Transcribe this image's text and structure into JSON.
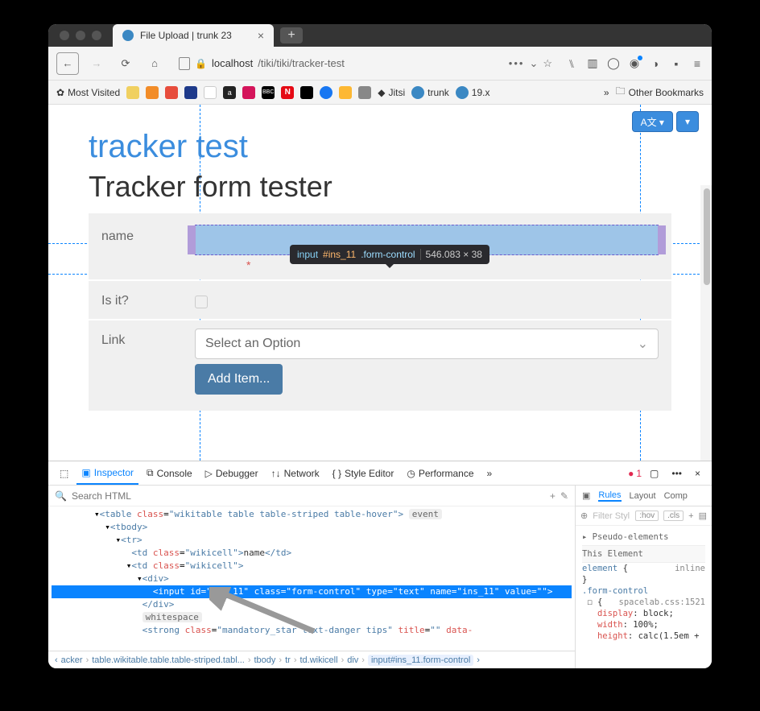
{
  "tab": {
    "title": "File Upload | trunk 23"
  },
  "url": {
    "host": "localhost",
    "path": "/tiki/tiki/tracker-test"
  },
  "bookmarks": {
    "most_visited": "Most Visited",
    "jitsi": "Jitsi",
    "trunk": "trunk",
    "v19": "19.x",
    "other": "Other Bookmarks"
  },
  "page": {
    "title": "tracker test",
    "subtitle": "Tracker form tester",
    "inspect_tooltip": {
      "tag": "input",
      "id": "#ins_11",
      "cls": ".form-control",
      "dim": "546.083 × 38"
    },
    "form": {
      "name_label": "name",
      "name_value": "",
      "isit_label": "Is it?",
      "link_label": "Link",
      "select_placeholder": "Select an Option",
      "add_button": "Add Item..."
    }
  },
  "devtools": {
    "tabs": {
      "inspector": "Inspector",
      "console": "Console",
      "debugger": "Debugger",
      "network": "Network",
      "style": "Style Editor",
      "perf": "Performance"
    },
    "search_placeholder": "Search HTML",
    "error_count": "1",
    "markup": {
      "l1": "<table class=\"wikitable table table-striped table-hover\">",
      "l1_badge": "event",
      "l2": "<tbody>",
      "l3": "<tr>",
      "l4_open": "<td class=\"wikicell\">",
      "l4_text": "name",
      "l4_close": "</td>",
      "l5": "<td class=\"wikicell\">",
      "l6": "<div>",
      "l7": "<input id=\"ins_11\" class=\"form-control\" type=\"text\" name=\"ins_11\" value=\"\">",
      "l8": "</div>",
      "l9_badge": "whitespace",
      "l10": "<strong class=\"mandatory_star text-danger tips\" title=\"\" data-"
    },
    "side": {
      "tabs": {
        "rules": "Rules",
        "layout": "Layout",
        "comp": "Comp"
      },
      "filter_placeholder": "Filter Styl",
      "hov": ":hov",
      "cls": ".cls",
      "pseudo": "Pseudo-elements",
      "this_el": "This Element",
      "rule1_sel": "element",
      "rule1_brace": "{",
      "rule1_src": "inline",
      "rule2_sel": ".form-control",
      "rule2_src": "spacelab.css:1521",
      "decls": [
        {
          "prop": "display",
          "val": "block"
        },
        {
          "prop": "width",
          "val": "100%"
        },
        {
          "prop": "height",
          "val": "calc(1.5em +"
        }
      ]
    },
    "breadcrumb": [
      "acker",
      "table.wikitable.table.table-striped.tabl...",
      "tbody",
      "tr",
      "td.wikicell",
      "div",
      "input#ins_11.form-control"
    ]
  }
}
